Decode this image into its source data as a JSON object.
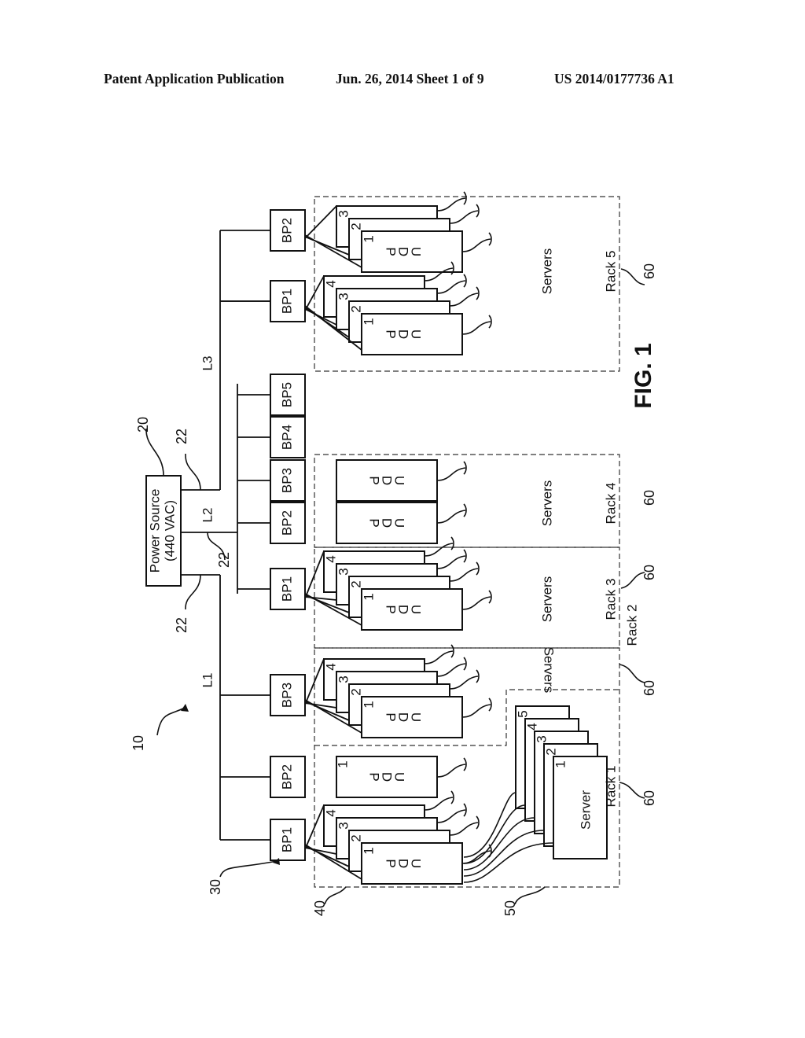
{
  "header": {
    "publication": "Patent Application Publication",
    "date_sheet": "Jun. 26, 2014  Sheet 1 of 9",
    "number": "US 2014/0177736 A1"
  },
  "figure": {
    "label": "FIG. 1",
    "power_source": {
      "line1": "Power Source",
      "line2": "(440 VAC)"
    },
    "lines": [
      "L1",
      "L2",
      "L3"
    ],
    "pdu_letters": [
      "P",
      "D",
      "U"
    ],
    "servers_label": "Servers",
    "server_label": "Server",
    "refs": {
      "system": "10",
      "power_source": "20",
      "line": "22",
      "branch_panel": "30",
      "pdu_group": "40",
      "server_group": "50",
      "rack": "60"
    },
    "racks": [
      {
        "name": "Rack 1",
        "bps": [
          "BP1",
          "BP2"
        ],
        "servers": [
          "1",
          "2",
          "3",
          "4",
          "5"
        ]
      },
      {
        "name": "Rack 2",
        "bps": [
          "BP3"
        ]
      },
      {
        "name": "Rack 3",
        "bps": [
          "BP1"
        ]
      },
      {
        "name": "Rack 4",
        "bps": [
          "BP2",
          "BP3"
        ]
      },
      {
        "name": "Rack 5",
        "bps": [
          "BP1",
          "BP2"
        ]
      }
    ],
    "spare_bps": [
      "BP4",
      "BP5"
    ],
    "pdu_stack_numbers": [
      "1",
      "2",
      "3",
      "4"
    ]
  }
}
